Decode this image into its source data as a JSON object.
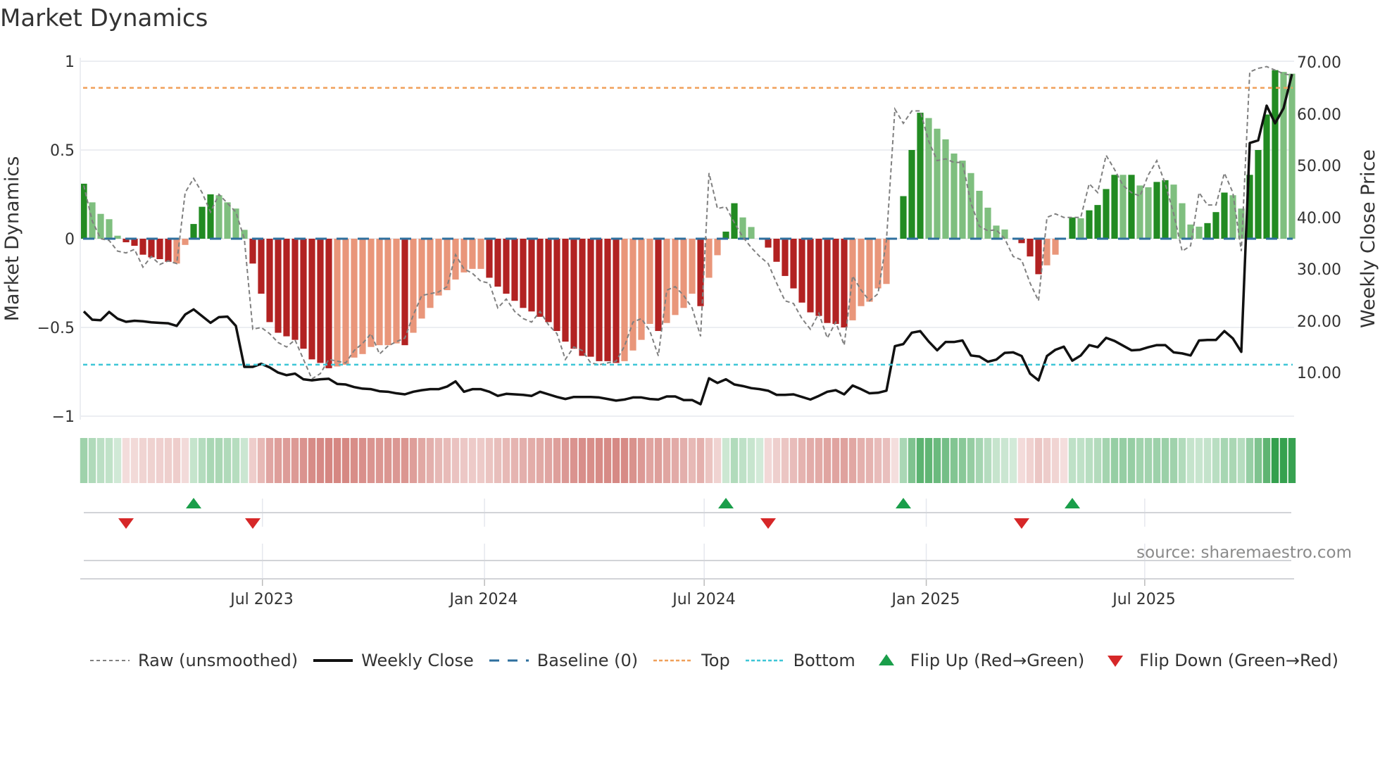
{
  "title": "Market Dynamics",
  "source": "source: sharemaestro.com",
  "legend": {
    "raw": "Raw (unsmoothed)",
    "close": "Weekly Close",
    "baseline": "Baseline (0)",
    "top": "Top",
    "bottom": "Bottom",
    "flip_up": "Flip Up (Red→Green)",
    "flip_down": "Flip Down (Green→Red)"
  },
  "colors": {
    "dark_green": "#228b22",
    "light_green": "#7fbf7f",
    "dark_red": "#b22222",
    "light_red": "#e9967a",
    "raw": "#808080",
    "close": "#111111",
    "baseline": "#2e6f9e",
    "top": "#f0a05a",
    "bottom": "#3ec6d6",
    "flip_up": "#1a9e4a",
    "flip_down": "#d62728",
    "strip_green": "#34a04e",
    "strip_red": "#cc6b65"
  },
  "chart_data": {
    "type": "bar",
    "title": "Market Dynamics",
    "ylabel": "Market Dynamics",
    "y2label": "Weekly Close Price",
    "ylim": [
      -1,
      1
    ],
    "y2lim": [
      1.5,
      70
    ],
    "yticks": [
      "1",
      "0.5",
      "0",
      "−0.5",
      "−1"
    ],
    "y2ticks": [
      "70.00",
      "60.00",
      "50.00",
      "40.00",
      "30.00",
      "20.00",
      "10.00"
    ],
    "xticks": [
      "Jul 2023",
      "Jan 2024",
      "Jul 2024",
      "Jan 2025",
      "Jul 2025"
    ],
    "start_week": "2023-02-03",
    "frequency": "weekly",
    "top_level": 0.85,
    "bottom_level": -0.71,
    "baseline": 0,
    "dynamics": [
      0.31,
      0.205,
      0.14,
      0.11,
      0.017,
      -0.02,
      -0.04,
      -0.09,
      -0.105,
      -0.115,
      -0.13,
      -0.14,
      -0.035,
      0.083,
      0.18,
      0.25,
      0.245,
      0.205,
      0.17,
      0.05,
      -0.14,
      -0.31,
      -0.47,
      -0.53,
      -0.55,
      -0.57,
      -0.62,
      -0.68,
      -0.7,
      -0.73,
      -0.72,
      -0.71,
      -0.67,
      -0.65,
      -0.61,
      -0.6,
      -0.6,
      -0.59,
      -0.6,
      -0.53,
      -0.45,
      -0.39,
      -0.32,
      -0.29,
      -0.23,
      -0.19,
      -0.17,
      -0.17,
      -0.22,
      -0.27,
      -0.31,
      -0.35,
      -0.39,
      -0.41,
      -0.44,
      -0.47,
      -0.52,
      -0.58,
      -0.62,
      -0.66,
      -0.665,
      -0.69,
      -0.69,
      -0.7,
      -0.69,
      -0.63,
      -0.57,
      -0.48,
      -0.52,
      -0.475,
      -0.43,
      -0.39,
      -0.31,
      -0.38,
      -0.22,
      -0.093,
      0.04,
      0.2,
      0.12,
      0.066,
      0,
      -0.05,
      -0.13,
      -0.21,
      -0.28,
      -0.36,
      -0.415,
      -0.435,
      -0.475,
      -0.48,
      -0.5,
      -0.46,
      -0.38,
      -0.355,
      -0.28,
      -0.255,
      0,
      0.24,
      0.5,
      0.71,
      0.68,
      0.62,
      0.56,
      0.48,
      0.44,
      0.37,
      0.27,
      0.175,
      0.074,
      0.052,
      0,
      -0.025,
      -0.1,
      -0.2,
      -0.15,
      -0.09,
      0,
      0.12,
      0.115,
      0.16,
      0.19,
      0.28,
      0.36,
      0.36,
      0.36,
      0.3,
      0.29,
      0.32,
      0.33,
      0.305,
      0.2,
      0.08,
      0.068,
      0.088,
      0.15,
      0.26,
      0.245,
      0.17,
      0.36,
      0.5,
      0.7,
      0.95,
      0.94,
      0.93
    ],
    "strength": "DLLLLDDDDDDLLDDDLLLLDDDDDDDDDDLLLLLLLLDLLLLLLLLLDDDDDDDDDDDDDDDDLLLLDLLLLDLLDDLLLDDDDDDDDDDLLLLLLDDDLLLLLLLLLLLDDDLLLDLDDDDLDLLDDLLLLDDDLLDDDDLL",
    "raw": [
      0.3,
      0.1,
      0.0,
      -0.01,
      -0.07,
      -0.08,
      -0.06,
      -0.16,
      -0.1,
      -0.145,
      -0.125,
      -0.14,
      0.26,
      0.34,
      0.26,
      0.15,
      0.25,
      0.2,
      0.15,
      0.0,
      -0.51,
      -0.5,
      -0.535,
      -0.585,
      -0.61,
      -0.57,
      -0.68,
      -0.79,
      -0.76,
      -0.68,
      -0.69,
      -0.7,
      -0.63,
      -0.59,
      -0.535,
      -0.65,
      -0.605,
      -0.58,
      -0.56,
      -0.43,
      -0.32,
      -0.31,
      -0.3,
      -0.27,
      -0.09,
      -0.17,
      -0.195,
      -0.24,
      -0.25,
      -0.39,
      -0.34,
      -0.41,
      -0.45,
      -0.47,
      -0.41,
      -0.485,
      -0.535,
      -0.68,
      -0.61,
      -0.63,
      -0.7,
      -0.71,
      -0.7,
      -0.69,
      -0.605,
      -0.47,
      -0.45,
      -0.52,
      -0.66,
      -0.29,
      -0.27,
      -0.32,
      -0.39,
      -0.55,
      0.37,
      0.17,
      0.18,
      0.09,
      0.01,
      -0.05,
      -0.1,
      -0.14,
      -0.25,
      -0.35,
      -0.365,
      -0.45,
      -0.51,
      -0.42,
      -0.56,
      -0.47,
      -0.6,
      -0.21,
      -0.29,
      -0.35,
      -0.31,
      -0.01,
      0.73,
      0.65,
      0.72,
      0.72,
      0.55,
      0.44,
      0.45,
      0.43,
      0.43,
      0.2,
      0.07,
      0.045,
      0.05,
      0.0,
      -0.1,
      -0.12,
      -0.25,
      -0.35,
      0.12,
      0.14,
      0.12,
      0.12,
      0.12,
      0.31,
      0.26,
      0.47,
      0.39,
      0.3,
      0.26,
      0.24,
      0.36,
      0.44,
      0.31,
      0.14,
      -0.07,
      -0.04,
      0.26,
      0.19,
      0.19,
      0.37,
      0.26,
      -0.07,
      0.94,
      0.96,
      0.97,
      0.95,
      0.93,
      0.92
    ],
    "weekly_close": [
      21.8,
      20.2,
      20.1,
      21.7,
      20.4,
      19.8,
      20.0,
      19.9,
      19.7,
      19.6,
      19.5,
      19.0,
      21.2,
      22.2,
      20.9,
      19.6,
      20.7,
      20.8,
      19.0,
      11.1,
      11.1,
      11.7,
      11.0,
      10.0,
      9.5,
      9.8,
      8.7,
      8.5,
      8.7,
      8.8,
      7.8,
      7.7,
      7.2,
      6.9,
      6.8,
      6.4,
      6.3,
      6.0,
      5.8,
      6.3,
      6.6,
      6.8,
      6.8,
      7.3,
      8.3,
      6.3,
      6.8,
      6.8,
      6.3,
      5.5,
      5.9,
      5.8,
      5.7,
      5.5,
      6.3,
      5.8,
      5.3,
      4.9,
      5.3,
      5.3,
      5.3,
      5.2,
      4.9,
      4.6,
      4.8,
      5.2,
      5.2,
      4.9,
      4.8,
      5.4,
      5.4,
      4.7,
      4.7,
      3.9,
      8.9,
      8.0,
      8.7,
      7.7,
      7.4,
      7.0,
      6.8,
      6.5,
      5.7,
      5.7,
      5.8,
      5.3,
      4.8,
      5.5,
      6.3,
      6.6,
      5.8,
      7.5,
      6.8,
      6.0,
      6.1,
      6.5,
      15.1,
      15.5,
      17.7,
      18.0,
      16.0,
      14.3,
      15.9,
      15.9,
      16.2,
      13.3,
      13.1,
      12.1,
      12.5,
      13.8,
      13.9,
      13.2,
      9.8,
      8.5,
      13.2,
      14.4,
      15.0,
      12.3,
      13.3,
      15.3,
      14.9,
      16.7,
      16.1,
      15.2,
      14.3,
      14.4,
      14.9,
      15.3,
      15.3,
      13.9,
      13.7,
      13.3,
      16.2,
      16.3,
      16.3,
      18.0,
      16.6,
      14.0,
      54.3,
      54.8,
      61.5,
      58.1,
      61.0,
      67.6
    ],
    "flip_up_weeks": [
      14,
      77,
      98,
      118
    ],
    "flip_down_weeks": [
      6,
      21,
      82,
      112
    ],
    "legend_position": "bottom"
  }
}
